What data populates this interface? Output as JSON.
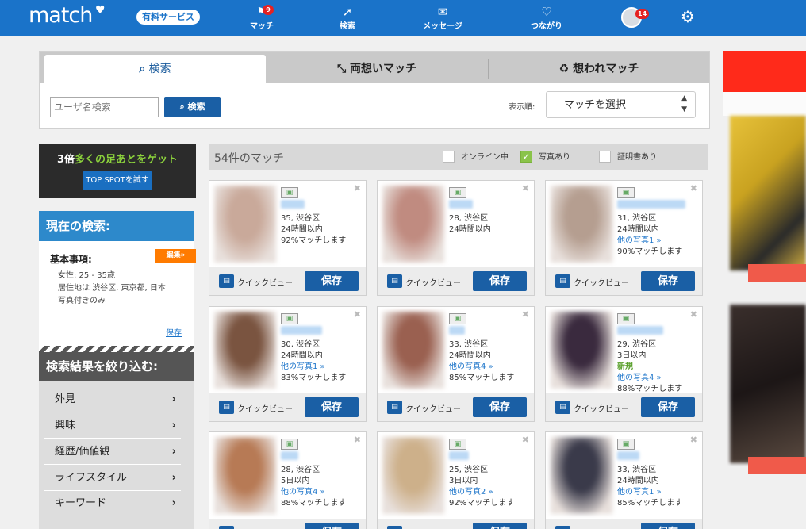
{
  "topnav": {
    "logo": "match",
    "paid_service": "有料サービス",
    "items": [
      {
        "label": "マッチ",
        "icon": "match-icon",
        "badge": "9"
      },
      {
        "label": "検索",
        "icon": "compass-icon"
      },
      {
        "label": "メッセージ",
        "icon": "mail-icon"
      },
      {
        "label": "つながり",
        "icon": "heart-icon"
      }
    ],
    "avatar_badge": "14"
  },
  "search_tabs": [
    {
      "label": "検索"
    },
    {
      "label": "両想いマッチ"
    },
    {
      "label": "想われマッチ"
    }
  ],
  "search": {
    "username_placeholder": "ユーザ名検索",
    "button": "検索",
    "sort_label": "表示順:",
    "sort_value": "マッチを選択"
  },
  "banner": {
    "text_prefix": "3倍",
    "text_highlight": "多くの足あとをゲット",
    "button": "TOP SPOTを試す"
  },
  "current_search": {
    "title": "現在の検索:",
    "basic_title": "基本事項:",
    "edit": "編集»",
    "criteria": [
      "女性: 25 - 35歳",
      "居住地は 渋谷区, 東京都, 日本",
      "写真付きのみ"
    ],
    "save": "保存"
  },
  "refine": {
    "title": "検索結果を絞り込む:",
    "items": [
      "外見",
      "興味",
      "経歴/価値観",
      "ライフスタイル",
      "キーワード"
    ]
  },
  "results": {
    "count": "54件のマッチ",
    "filters": [
      {
        "label": "オンライン中",
        "checked": false
      },
      {
        "label": "写真あり",
        "checked": true
      },
      {
        "label": "証明書あり",
        "checked": false
      }
    ]
  },
  "card_labels": {
    "quick_view": "クイックビュー",
    "save": "保存"
  },
  "cards": [
    {
      "lines": [
        "35, 渋谷区",
        "24時間以内",
        "92%マッチします"
      ],
      "link_line": null,
      "photo": "#c9a99a"
    },
    {
      "lines": [
        "28, 渋谷区",
        "24時間以内"
      ],
      "link_line": null,
      "photo": "#c08b80"
    },
    {
      "lines": [
        "31, 渋谷区",
        "24時間以内",
        "他の写真1 »",
        "90%マッチします"
      ],
      "link_line": 2,
      "photo": "#b59e90"
    },
    {
      "lines": [
        "30, 渋谷区",
        "24時間以内",
        "他の写真1 »",
        "83%マッチします"
      ],
      "link_line": 2,
      "photo": "#7a5440"
    },
    {
      "lines": [
        "33, 渋谷区",
        "24時間以内",
        "他の写真4 »",
        "85%マッチします"
      ],
      "link_line": 2,
      "photo": "#9a6050"
    },
    {
      "lines": [
        "29, 渋谷区",
        "3日以内",
        "新規",
        "他の写真4 »",
        "88%マッチします"
      ],
      "link_line": 3,
      "new_line": 2,
      "photo": "#3a2a3e"
    },
    {
      "lines": [
        "28, 渋谷区",
        "5日以内",
        "他の写真4 »",
        "88%マッチします"
      ],
      "link_line": 2,
      "photo": "#b77a55"
    },
    {
      "lines": [
        "25, 渋谷区",
        "3日以内",
        "他の写真2 »",
        "92%マッチします"
      ],
      "link_line": 2,
      "photo": "#cdb08a"
    },
    {
      "lines": [
        "33, 渋谷区",
        "24時間以内",
        "他の写真1 »",
        "85%マッチします"
      ],
      "link_line": 2,
      "photo": "#3a3a4a"
    }
  ],
  "colors": {
    "nav_blue": "#1a73c9",
    "button_blue": "#1a5fa5",
    "search_header_blue": "#2d89cb",
    "edit_orange": "#ff7b00",
    "banner_green": "#8bd13c"
  }
}
